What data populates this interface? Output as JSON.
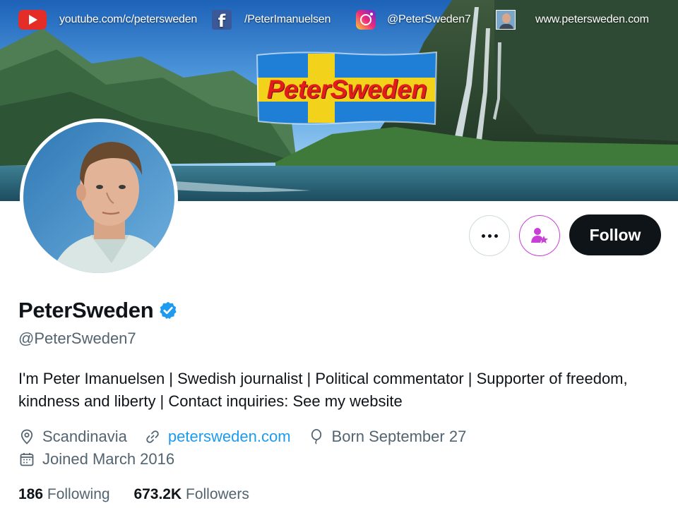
{
  "banner": {
    "youtube_text": "youtube.com/c/petersweden",
    "facebook_text": "/PeterImanuelsen",
    "instagram_text": "@PeterSweden7",
    "website_text": "www.petersweden.com",
    "logo_text": "PeterSweden",
    "icons": [
      "youtube-icon",
      "facebook-icon",
      "instagram-icon",
      "profile-thumbnail"
    ]
  },
  "profile": {
    "display_name": "PeterSweden",
    "handle": "@PeterSweden7",
    "verified": true,
    "bio": "I'm Peter Imanuelsen | Swedish journalist | Political commentator | Supporter of freedom, kindness and liberty | Contact inquiries: See my website",
    "location": "Scandinavia",
    "website": "petersweden.com",
    "birthday": "Born September 27",
    "joined": "Joined March 2016"
  },
  "actions": {
    "more_icon": "more-dots-icon",
    "subscribe_icon": "subscribe-star-icon",
    "follow_label": "Follow"
  },
  "stats": {
    "following_count": "186",
    "following_label": "Following",
    "followers_count": "673.2K",
    "followers_label": "Followers"
  },
  "colors": {
    "accent_blue": "#1d9bf0",
    "secondary_text": "#536471",
    "primary_text": "#0f1419",
    "follow_button": "#0f1419",
    "subscribe_purple": "#c940d6"
  }
}
